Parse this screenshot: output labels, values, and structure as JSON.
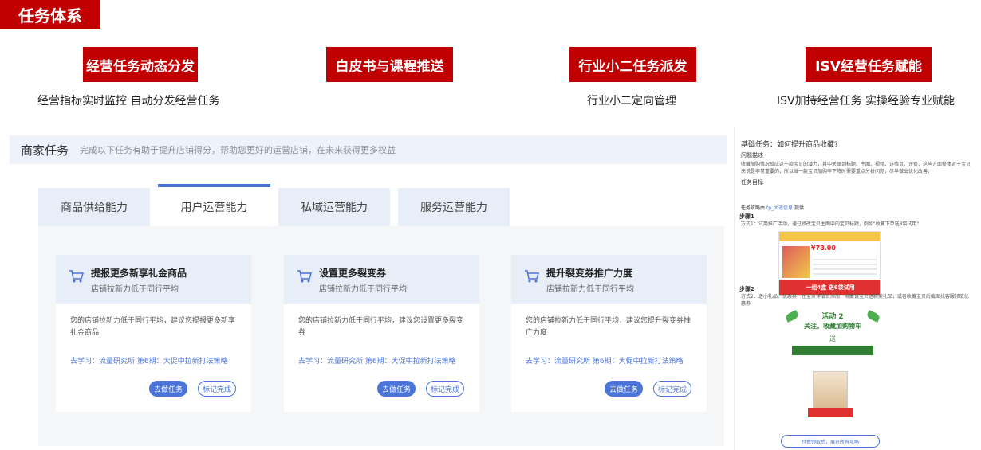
{
  "page_title": "任务体系",
  "features": [
    {
      "label": "经营任务动态分发",
      "desc": "经营指标实时监控  自动分发经营任务"
    },
    {
      "label": "白皮书与课程推送",
      "desc": ""
    },
    {
      "label": "行业小二任务派发",
      "desc": "行业小二定向管理"
    },
    {
      "label": "ISV经营任务赋能",
      "desc": "ISV加持经营任务  实操经验专业赋能"
    }
  ],
  "panel": {
    "title": "商家任务",
    "subtitle": "完成以下任务有助于提升店铺得分，帮助您更好的运营店铺，在未来获得更多权益"
  },
  "tabs": [
    {
      "label": "商品供给能力"
    },
    {
      "label": "用户运营能力"
    },
    {
      "label": "私域运营能力"
    },
    {
      "label": "服务运营能力"
    }
  ],
  "cards": [
    {
      "title": "提报更多新享礼金商品",
      "subtitle": "店铺拉新力低于同行平均",
      "body": "您的店铺拉新力低于同行平均，建议您提报更多新享礼金商品",
      "link": "去学习：流量研究所 第6期：大促中拉新打法策略",
      "do_label": "去做任务",
      "mark_label": "标记完成"
    },
    {
      "title": "设置更多裂变券",
      "subtitle": "店铺拉新力低于同行平均",
      "body": "您的店铺拉新力低于同行平均，建议您设置更多裂变券",
      "link": "去学习：流量研究所 第6期：大促中拉新打法策略",
      "do_label": "去做任务",
      "mark_label": "标记完成"
    },
    {
      "title": "提升裂变券推广力度",
      "subtitle": "店铺拉新力低于同行平均",
      "body": "您的店铺拉新力低于同行平均，建议您提升裂变券推广力度",
      "link": "去学习：流量研究所 第6期：大促中拉新打法策略",
      "do_label": "去做任务",
      "mark_label": "标记完成"
    }
  ],
  "side": {
    "question": "基础任务：如何提升商品收藏?",
    "problem_label": "问题描述",
    "problem_text": "收藏加购情况反应这一款宝贝的潜力，其中关联到标题、主图、视频、详情页、评价、这些方面整体对于宝贝来说是非常重要的，所以当一款宝贝加购率下降时需要重点分析问题，尽早做出优化改善。",
    "goal_label": "任务目标",
    "provider_prefix": "任务攻略由",
    "provider_name": "tp_大道信息",
    "provider_suffix": "提供",
    "step1_label": "步骤1",
    "step1_text": "方式1：试用推广活动，通过修改宝贝主图中的宝贝标题，例如\"收藏下单送8袋试用\"",
    "img1_price": "¥78.00",
    "img1_banner": "一组4盒 送6袋试用",
    "step2_label": "步骤2",
    "step2_text": "方式2：送小礼品、优惠券，在宝贝详情页添加，收藏该宝贝送精美礼品，或者收藏宝贝后截图找客服领取优惠券",
    "img2_title": "活动 2",
    "img2_sub": "关注，收藏加购物车",
    "img2_song": "送",
    "more_btn": "付费领取后，展开所有攻略"
  }
}
